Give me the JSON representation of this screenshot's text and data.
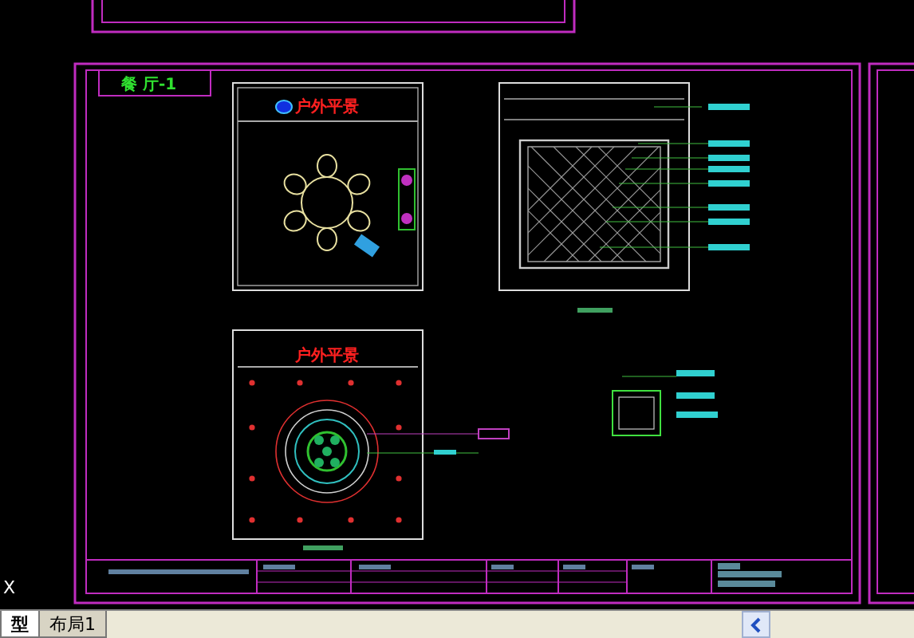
{
  "drawing": {
    "sheet_title": "餐 厅-1",
    "plan_labels": [
      "户外平景",
      "户外平景"
    ],
    "axis_label": "X"
  },
  "tabs": [
    {
      "label": "型",
      "selected": true
    },
    {
      "label": "布局1",
      "selected": false
    }
  ]
}
